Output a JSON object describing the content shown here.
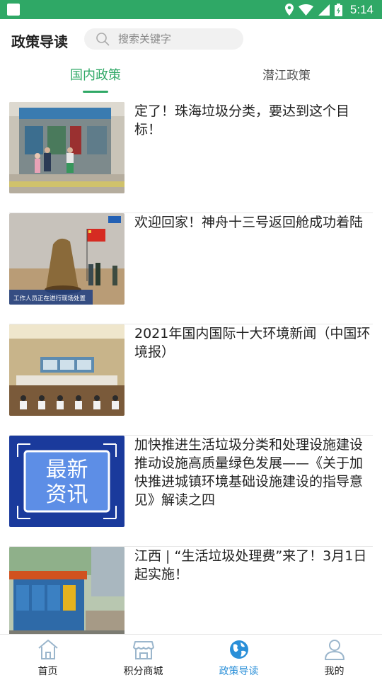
{
  "status_bar": {
    "time": "5:14",
    "background": "#2fa866"
  },
  "header": {
    "title": "政策导读",
    "search": {
      "placeholder": "搜索关键字",
      "value": ""
    }
  },
  "tabs": [
    {
      "label": "国内政策",
      "active": true
    },
    {
      "label": "潜江政策",
      "active": false
    }
  ],
  "news": [
    {
      "title": "定了！珠海垃圾分类，要达到这个目标！"
    },
    {
      "title": "欢迎回家！神舟十三号返回舱成功着陆",
      "thumb_caption": "工作人员正在进行现场处置"
    },
    {
      "title": "2021年国内国际十大环境新闻（中国环境报）"
    },
    {
      "title": "加快推进生活垃圾分类和处理设施建设 推动设施高质量绿色发展——《关于加快推进城镇环境基础设施建设的指导意见》解读之四",
      "thumb_text_line1": "最新",
      "thumb_text_line2": "资讯"
    },
    {
      "title": "江西 | “生活垃圾处理费”来了！3月1日起实施！"
    }
  ],
  "bottom_nav": [
    {
      "label": "首页",
      "icon": "home-icon",
      "active": false
    },
    {
      "label": "积分商城",
      "icon": "store-icon",
      "active": false
    },
    {
      "label": "政策导读",
      "icon": "globe-icon",
      "active": true
    },
    {
      "label": "我的",
      "icon": "user-icon",
      "active": false
    }
  ],
  "colors": {
    "accent_green": "#2fa866",
    "nav_active_blue": "#2a8fd8"
  }
}
